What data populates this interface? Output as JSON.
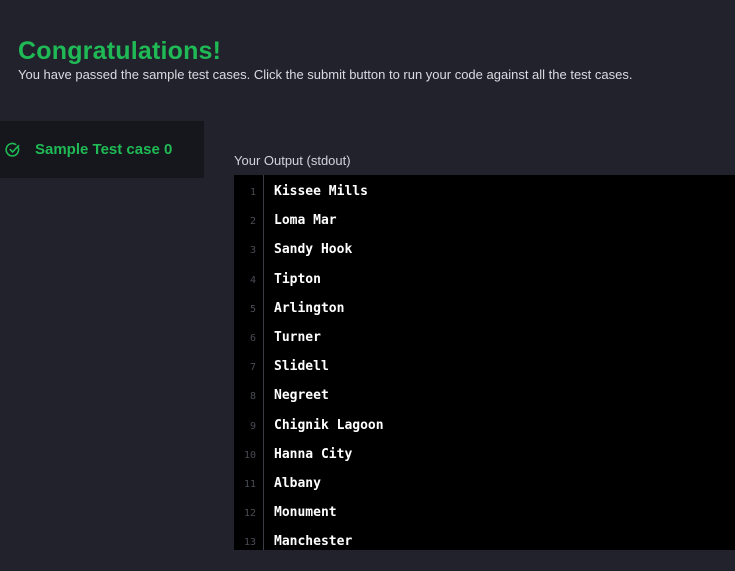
{
  "header": {
    "title": "Congratulations!",
    "subtitle": "You have passed the sample test cases. Click the submit button to run your code against all the test cases."
  },
  "sidebar": {
    "testcase": {
      "label": "Sample Test case 0",
      "icon": "check-circle-icon",
      "status": "passed",
      "color": "#1fba55"
    }
  },
  "output": {
    "label": "Your Output (stdout)",
    "lines": [
      {
        "num": "1",
        "text": "Kissee Mills"
      },
      {
        "num": "2",
        "text": "Loma Mar"
      },
      {
        "num": "3",
        "text": "Sandy Hook"
      },
      {
        "num": "4",
        "text": "Tipton"
      },
      {
        "num": "5",
        "text": "Arlington"
      },
      {
        "num": "6",
        "text": "Turner"
      },
      {
        "num": "7",
        "text": "Slidell"
      },
      {
        "num": "8",
        "text": "Negreet"
      },
      {
        "num": "9",
        "text": "Chignik Lagoon"
      },
      {
        "num": "10",
        "text": "Hanna City"
      },
      {
        "num": "11",
        "text": "Albany"
      },
      {
        "num": "12",
        "text": "Monument"
      },
      {
        "num": "13",
        "text": "Manchester"
      }
    ]
  },
  "colors": {
    "accent": "#1fba55",
    "background": "#22222c",
    "output_background": "#000000"
  }
}
